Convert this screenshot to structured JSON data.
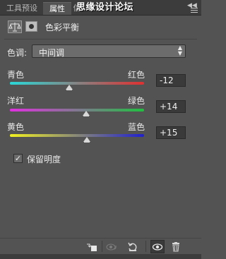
{
  "tabs": [
    "工具预设",
    "属性",
    "信"
  ],
  "watermark": "思缘设计论坛",
  "panel": {
    "title": "色彩平衡"
  },
  "tone": {
    "label": "色调:",
    "value": "中间调"
  },
  "sliders": [
    {
      "left": "青色",
      "right": "红色",
      "value": "-12",
      "position_fraction": 0.44,
      "gradient": [
        "#2ad7d7",
        "#e03030"
      ]
    },
    {
      "left": "洋红",
      "right": "绿色",
      "value": "+14",
      "position_fraction": 0.57,
      "gradient": [
        "#e030e0",
        "#20c040"
      ]
    },
    {
      "left": "黄色",
      "right": "蓝色",
      "value": "+15",
      "position_fraction": 0.575,
      "gradient": [
        "#f0f020",
        "#2020d0"
      ]
    }
  ],
  "preserve_luminosity": {
    "label": "保留明度",
    "checked": true
  },
  "colors": {
    "panel_bg": "#535353",
    "tab_bg": "#3c3c3c",
    "field_bg": "#3a3a3a"
  },
  "footer_icons": [
    "clip-to-layer-icon",
    "view-previous-icon",
    "reset-icon",
    "visibility-eye-icon",
    "trash-icon"
  ]
}
